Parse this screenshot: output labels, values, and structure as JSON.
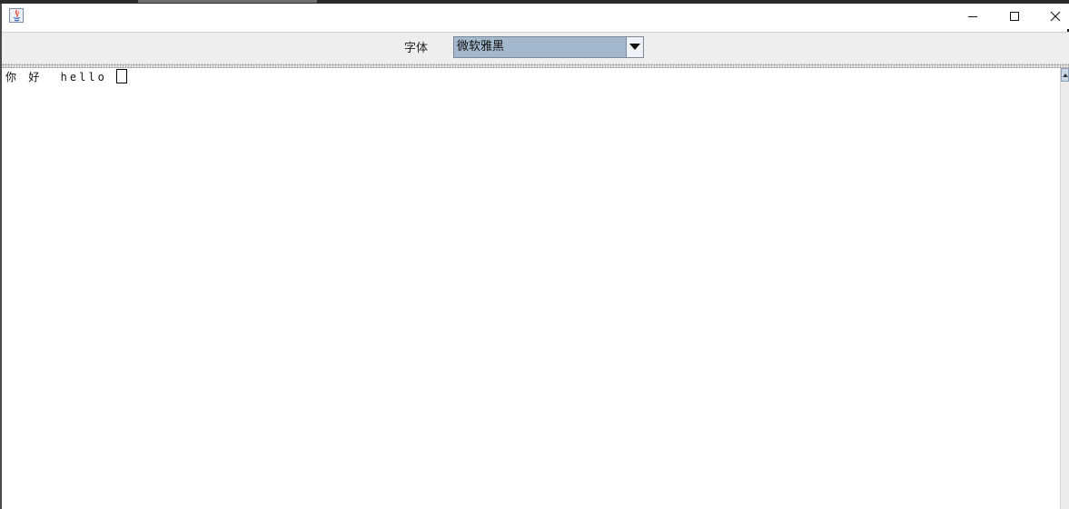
{
  "window": {
    "icon": "java-app-icon",
    "controls": [
      "minimize-icon",
      "maximize-icon",
      "close-icon"
    ]
  },
  "toolbar": {
    "font_label": "字体",
    "font_select": {
      "selected": "微软雅黑",
      "icon": "chevron-down-icon"
    }
  },
  "editor": {
    "text": "你 好  hello"
  },
  "scrollbar": {
    "icon": "arrow-up-icon"
  },
  "colors": {
    "selection_bg": "#a3b8cc",
    "toolbar_bg": "#eeeeee",
    "editor_bg": "#ffffff"
  }
}
